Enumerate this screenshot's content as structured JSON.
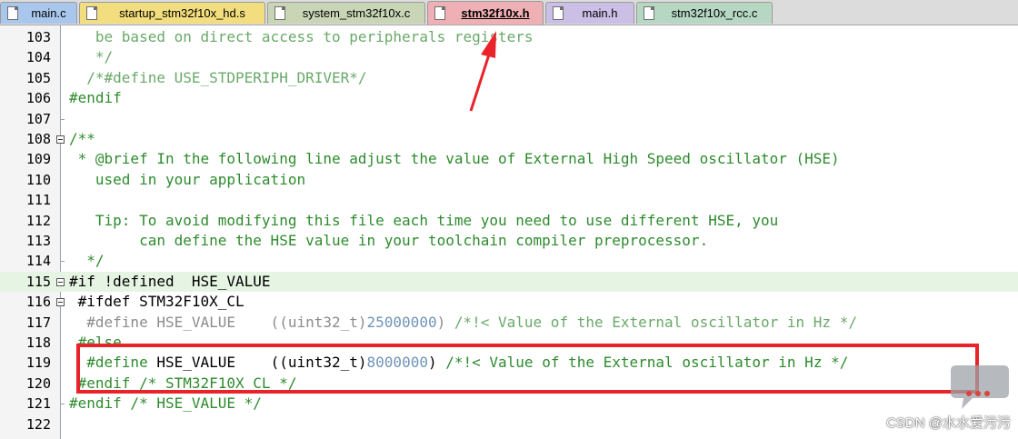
{
  "tabs": [
    {
      "label": "main.c",
      "color": "#a9c7ec",
      "active": false
    },
    {
      "label": "startup_stm32f10x_hd.s",
      "color": "#f2de7e",
      "active": false
    },
    {
      "label": "system_stm32f10x.c",
      "color": "#c9d6b6",
      "active": false
    },
    {
      "label": "stm32f10x.h",
      "color": "#eeb0b4",
      "active": true
    },
    {
      "label": "main.h",
      "color": "#cbbfe5",
      "active": false
    },
    {
      "label": "stm32f10x_rcc.c",
      "color": "#b6d8c3",
      "active": false
    }
  ],
  "colors": {
    "comment": "#2e8b2e",
    "comment_faded": "#6aa96a",
    "preprocessor": "#000000",
    "preprocessor_inactive": "#8c8c8c",
    "number": "#6f93b8",
    "highlight": "#e6f5e3",
    "annotation_red": "#e8242a"
  },
  "lines": [
    {
      "num": "103",
      "segments": [
        {
          "text": "   be based on direct access to peripherals registers",
          "kind": "comment_faded"
        }
      ]
    },
    {
      "num": "104",
      "segments": [
        {
          "text": "   */",
          "kind": "comment_faded"
        }
      ]
    },
    {
      "num": "105",
      "segments": [
        {
          "text": "  /*#define USE_STDPERIPH_DRIVER*/",
          "kind": "comment_faded"
        }
      ]
    },
    {
      "num": "106",
      "segments": [
        {
          "text": "#endif",
          "kind": "comment"
        }
      ]
    },
    {
      "num": "107",
      "segments": [
        {
          "text": "",
          "kind": "code"
        }
      ]
    },
    {
      "num": "108",
      "segments": [
        {
          "text": "/**",
          "kind": "comment"
        }
      ]
    },
    {
      "num": "109",
      "segments": [
        {
          "text": " * @brief In the following line adjust the value of External High Speed oscillator (HSE)",
          "kind": "comment"
        }
      ]
    },
    {
      "num": "110",
      "segments": [
        {
          "text": "   used in your application",
          "kind": "comment"
        }
      ]
    },
    {
      "num": "111",
      "segments": [
        {
          "text": "",
          "kind": "code"
        }
      ]
    },
    {
      "num": "112",
      "segments": [
        {
          "text": "   Tip: To avoid modifying this file each time you need to use different HSE, you",
          "kind": "comment"
        }
      ]
    },
    {
      "num": "113",
      "segments": [
        {
          "text": "        can define the HSE value in your toolchain compiler preprocessor.",
          "kind": "comment"
        }
      ]
    },
    {
      "num": "114",
      "segments": [
        {
          "text": "  */",
          "kind": "comment"
        }
      ]
    },
    {
      "num": "115",
      "segments": [
        {
          "text": "#if !defined  HSE_VALUE",
          "kind": "preprocessor"
        }
      ]
    },
    {
      "num": "116",
      "segments": [
        {
          "text": " #ifdef STM32F10X_CL",
          "kind": "preprocessor"
        }
      ]
    },
    {
      "num": "117",
      "segments": [
        {
          "text": "  #define HSE_VALUE    ((uint32_t)",
          "kind": "preprocessor_inactive"
        },
        {
          "text": "25000000",
          "kind": "number"
        },
        {
          "text": ") ",
          "kind": "preprocessor_inactive"
        },
        {
          "text": "/*!< Value of the External oscillator in Hz */",
          "kind": "comment_faded"
        }
      ]
    },
    {
      "num": "118",
      "segments": [
        {
          "text": " #else",
          "kind": "comment"
        }
      ]
    },
    {
      "num": "119",
      "segments": [
        {
          "text": "  #define",
          "kind": "comment"
        },
        {
          "text": " HSE_VALUE    ((uint32_t)",
          "kind": "preprocessor"
        },
        {
          "text": "8000000",
          "kind": "number"
        },
        {
          "text": ") ",
          "kind": "preprocessor"
        },
        {
          "text": "/*!< Value of the External oscillator in Hz */",
          "kind": "comment"
        }
      ]
    },
    {
      "num": "120",
      "segments": [
        {
          "text": " #endif /* STM32F10X_CL */",
          "kind": "comment"
        }
      ]
    },
    {
      "num": "121",
      "segments": [
        {
          "text": "#endif /* HSE_VALUE */",
          "kind": "comment"
        }
      ]
    },
    {
      "num": "122",
      "segments": [
        {
          "text": "",
          "kind": "code"
        }
      ]
    }
  ],
  "watermark": "CSDN @水水爱污污"
}
